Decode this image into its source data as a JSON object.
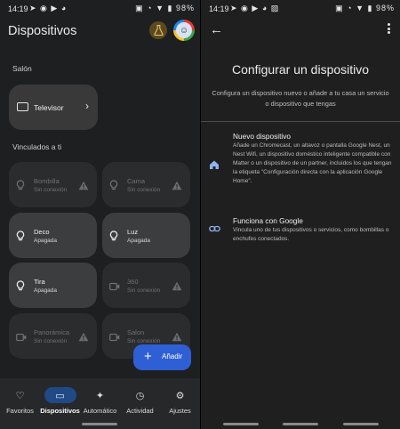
{
  "left": {
    "status": {
      "time": "14:19",
      "left_icons": "➤ ◉ ▶ ◕",
      "right_icons": "▣ ◔ ▼ ▮",
      "battery": "98%"
    },
    "header": {
      "title": "Dispositivos",
      "lab_icon": "flask-icon",
      "avatar_icon": "profile-avatar"
    },
    "sections": {
      "room": "Salón",
      "linked": "Vinculados a ti"
    },
    "room_device": {
      "name": "Televisor",
      "icon": "tv-icon"
    },
    "devices": [
      {
        "name": "Bombilla",
        "status": "Sin conexión",
        "state": "off",
        "icon": "bulb-icon"
      },
      {
        "name": "Cama",
        "status": "Sin conexión",
        "state": "off",
        "icon": "bulb-icon"
      },
      {
        "name": "Deco",
        "status": "Apagada",
        "state": "on",
        "icon": "bulb-icon"
      },
      {
        "name": "Luz",
        "status": "Apagada",
        "state": "on",
        "icon": "bulb-icon"
      },
      {
        "name": "Tira",
        "status": "Apagada",
        "state": "on",
        "icon": "bulb-icon"
      },
      {
        "name": "360",
        "status": "Sin conexión",
        "state": "off",
        "icon": "camera-icon"
      },
      {
        "name": "Panorámica",
        "status": "Sin conexión",
        "state": "off",
        "icon": "camera-icon"
      },
      {
        "name": "Salon",
        "status": "Sin conexión",
        "state": "off",
        "icon": "camera-icon"
      }
    ],
    "fab": {
      "label": "Añadir"
    },
    "nav": [
      {
        "label": "Favoritos",
        "icon": "heart-icon",
        "active": false
      },
      {
        "label": "Dispositivos",
        "icon": "devices-icon",
        "active": true
      },
      {
        "label": "Automático",
        "icon": "sparkle-icon",
        "active": false
      },
      {
        "label": "Actividad",
        "icon": "history-icon",
        "active": false
      },
      {
        "label": "Ajustes",
        "icon": "gear-icon",
        "active": false
      }
    ]
  },
  "right": {
    "status": {
      "time": "14:19",
      "left_icons": "➤ ◉ ▶ ◕ ▨",
      "right_icons": "▣ ◔ ▼ ▮",
      "battery": "98%"
    },
    "title": "Configurar un dispositivo",
    "subtitle": "Configura un dispositivo nuevo o añade a tu casa un servicio o dispositivo que tengas",
    "options": [
      {
        "title": "Nuevo dispositivo",
        "icon": "home-icon",
        "description": "Añade un Chromecast, un altavoz o pantalla Google Nest, un Nest Wifi, un dispositivo doméstico inteligente compatible con Matter o un dispositivo de un partner, incluidos los que tengan la etiqueta \"Configuración directa con la aplicación Google Home\"."
      },
      {
        "title": "Funciona con Google",
        "icon": "link-icon",
        "description": "Vincula uno de tus dispositivos o servicios, como bombillas o enchufes conectados."
      }
    ]
  },
  "colors": {
    "accent": "#2f5fd4",
    "active_pill": "#1f4a86",
    "card_on": "#3c3d3f",
    "card_off": "#2b2c2e",
    "home_icon": "#8fb3f0"
  }
}
